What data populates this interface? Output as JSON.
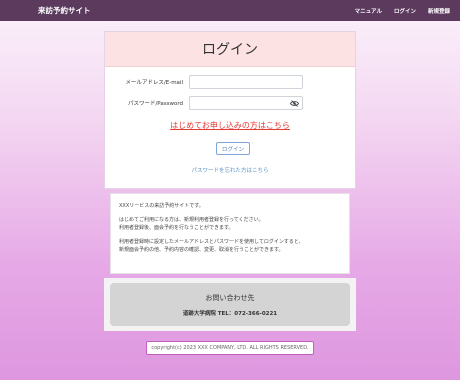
{
  "navbar": {
    "brand": "来訪予約サイト",
    "links": [
      "マニュアル",
      "ログイン",
      "新規登録"
    ]
  },
  "login": {
    "title": "ログイン",
    "email_label": "メールアドレス/E-mail",
    "email_value": "",
    "password_label": "パスワード/Password",
    "password_value": "",
    "password_toggle_icon": "eye-slash-icon",
    "signup_link": "はじめてお申し込みの方はこちら",
    "login_button": "ログイン",
    "forgot_link": "パスワードを忘れた方はこちら"
  },
  "info": {
    "line1": "XXXリービスの来訪予約サイトです。",
    "line2": "はじめてご利用になる方は、新規利用者登録を行ってください。",
    "line3": "利用者登録後、面会予約を行なうことができます。",
    "line4": "利用者登録時に設定したメールアドレスとパスワードを使用してログインすると、",
    "line5": "新規面会予約の他、予約内容の確認、変更、取消を行うことができます。"
  },
  "contact": {
    "title": "お問い合わせ先",
    "line": "道跡大学病院 TEL：072-366-0221"
  },
  "footer": {
    "copyright": "copyright(c) 2023 XXX COMPANY, LTD. ALL RIGHTS RESERVED."
  },
  "colors": {
    "navbar": "#5b3a5e",
    "card_header": "#fde2e4",
    "signup_link": "#e53935",
    "link_blue": "#5b8fc9"
  }
}
